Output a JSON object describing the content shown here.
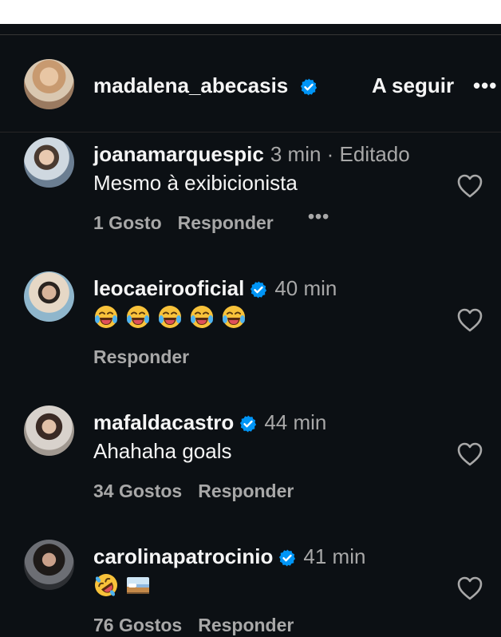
{
  "post": {
    "author": "madalena_abecasis",
    "follow_label": "A seguir",
    "more_label": "•••"
  },
  "comments": [
    {
      "user": "joanamarquespic",
      "verified": false,
      "meta": "3 min · Editado",
      "text": "Mesmo à exibicionista",
      "likes": "1 Gosto",
      "reply": "Responder",
      "more": "•••"
    },
    {
      "user": "leocaeirooficial",
      "verified": true,
      "meta": "40 min",
      "emojis": [
        "laughing-tears",
        "laughing-tears",
        "laughing-tears",
        "laughing-tears",
        "laughing-tears"
      ],
      "reply": "Responder"
    },
    {
      "user": "mafaldacastro",
      "verified": true,
      "meta": "44 min",
      "text": "Ahahaha goals",
      "likes": "34 Gostos",
      "reply": "Responder"
    },
    {
      "user": "carolinapatrocinio",
      "verified": true,
      "meta": "41 min",
      "emojis": [
        "rolling-laughing",
        "bed-with-picture"
      ],
      "likes": "76 Gostos",
      "reply": "Responder"
    }
  ],
  "colors": {
    "background": "#0c1014",
    "verified_blue": "#0095f6",
    "secondary_text": "#a8a8a8",
    "emoji_yellow": "#f8c23a"
  }
}
